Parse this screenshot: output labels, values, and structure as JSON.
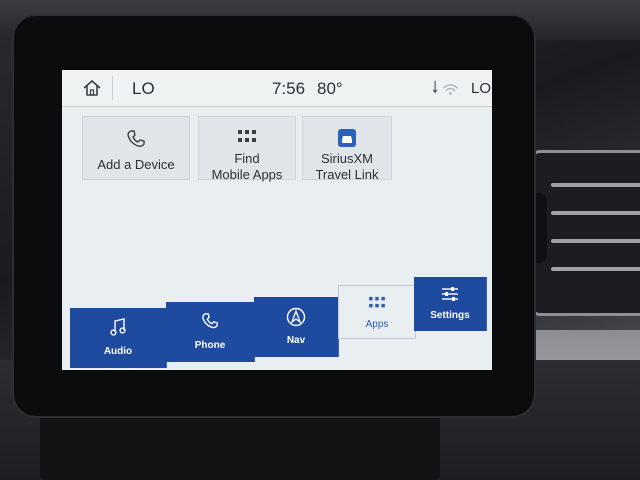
{
  "status_bar": {
    "left_temp": "LO",
    "time": "7:56",
    "outside_temp": "80°",
    "right_temp": "LO"
  },
  "apps": [
    {
      "label_lines": [
        "Add a Device"
      ],
      "icon": "phone-icon"
    },
    {
      "label_lines": [
        "Find",
        "Mobile Apps"
      ],
      "icon": "grid-icon"
    },
    {
      "label_lines": [
        "SiriusXM",
        "Travel Link"
      ],
      "icon": "car-icon"
    }
  ],
  "bottom_nav": [
    {
      "label": "Audio",
      "icon": "music-note-icon",
      "active": false
    },
    {
      "label": "Phone",
      "icon": "phone-icon",
      "active": false
    },
    {
      "label": "Nav",
      "icon": "navigation-arrow-icon",
      "active": false
    },
    {
      "label": "Apps",
      "icon": "grid-icon",
      "active": true
    },
    {
      "label": "Settings",
      "icon": "sliders-icon",
      "active": false
    }
  ],
  "colors": {
    "nav_blue": "#1e4aa0",
    "active_blue": "#2f5bb6",
    "screen_bg": "#e9eef0"
  }
}
